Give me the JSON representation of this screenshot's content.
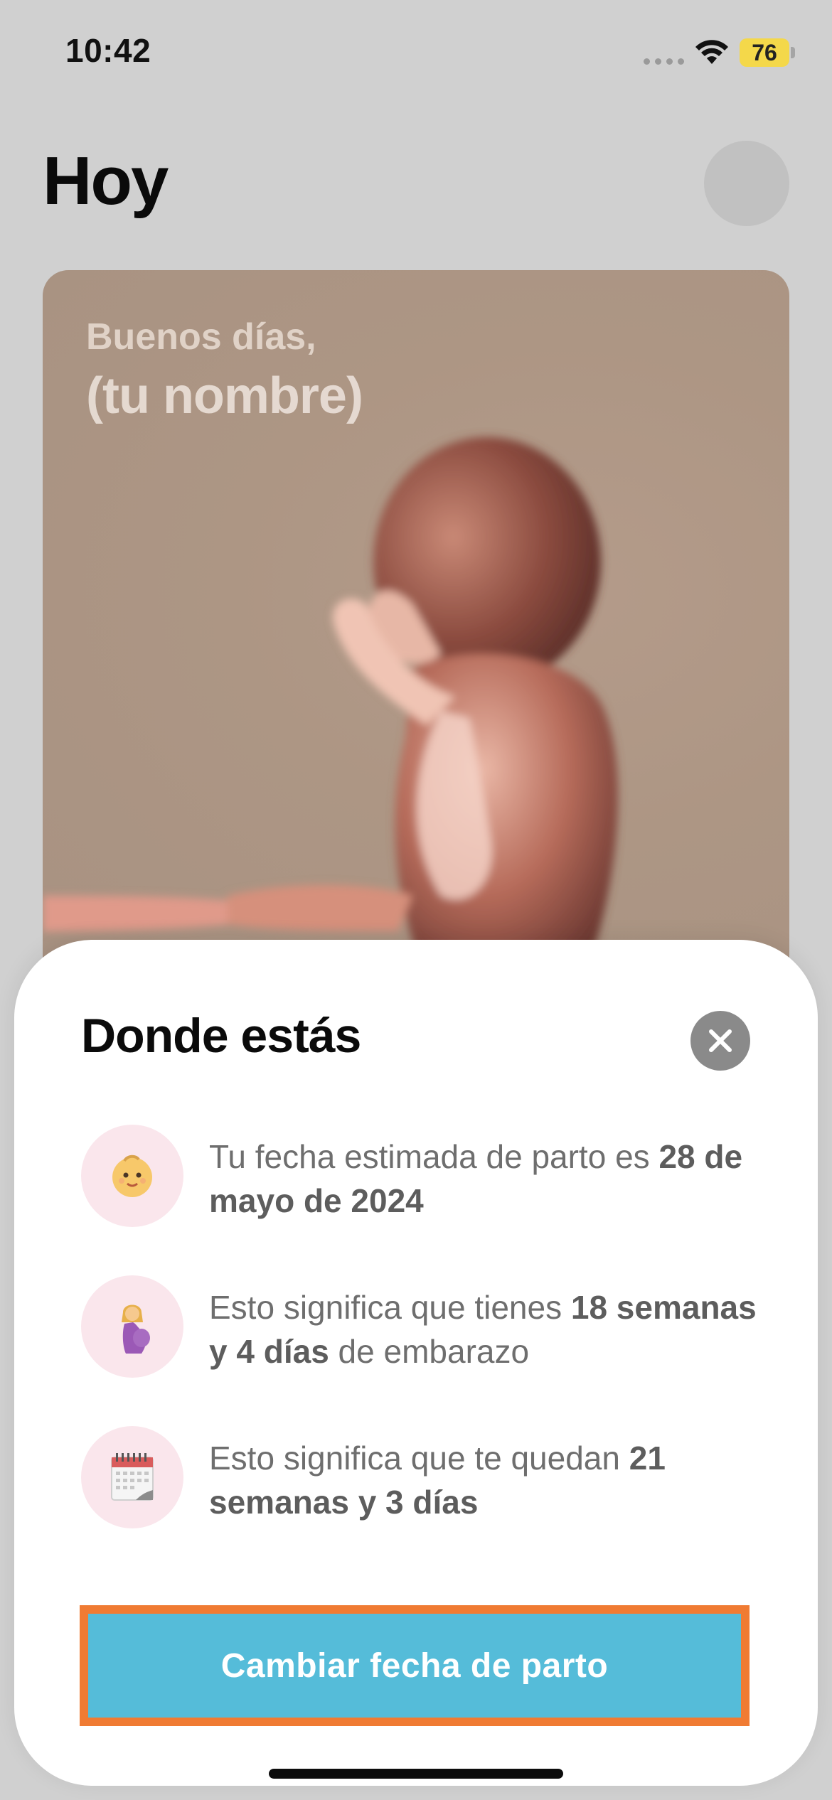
{
  "status_bar": {
    "time": "10:42",
    "battery": "76"
  },
  "header": {
    "title": "Hoy"
  },
  "hero": {
    "greeting": "Buenos días,",
    "name": "(tu nombre)"
  },
  "sheet": {
    "title": "Donde estás",
    "rows": [
      {
        "icon": "baby-face-icon",
        "text_a": "Tu fecha estimada de parto es ",
        "bold_a": "28 de mayo de 2024",
        "text_b": ""
      },
      {
        "icon": "pregnant-woman-icon",
        "text_a": "Esto significa que tienes ",
        "bold_a": "18 semanas y 4 días",
        "text_b": " de embarazo"
      },
      {
        "icon": "calendar-icon",
        "text_a": "Esto significa que te quedan ",
        "bold_a": "21 semanas y 3 días",
        "text_b": ""
      }
    ],
    "cta": "Cambiar fecha de parto"
  },
  "colors": {
    "accent": "#55bcd9",
    "highlight": "#f07b33",
    "icon_bg": "#fae6ec"
  }
}
